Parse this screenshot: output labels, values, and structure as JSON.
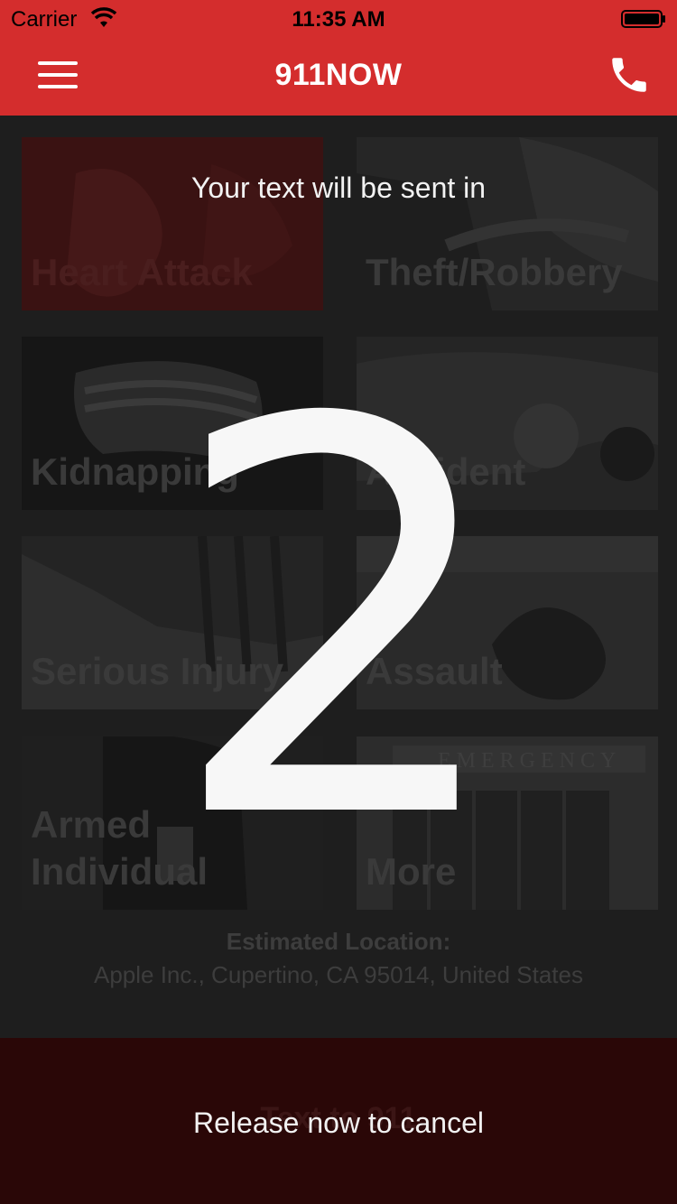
{
  "status_bar": {
    "carrier": "Carrier",
    "time": "11:35 AM",
    "wifi_icon": "wifi-icon",
    "battery_icon": "battery-icon"
  },
  "nav": {
    "title": "911NOW",
    "menu_icon": "hamburger-menu-icon",
    "call_icon": "phone-icon"
  },
  "colors": {
    "brand_red": "#d42d2d",
    "overlay_dark": "#1e1e1e",
    "bottom_bar": "#2a0707"
  },
  "tiles": [
    {
      "label": "Heart Attack"
    },
    {
      "label": "Theft/Robbery"
    },
    {
      "label": "Kidnapping"
    },
    {
      "label": "Accident"
    },
    {
      "label": "Serious Injury"
    },
    {
      "label": "Assault"
    },
    {
      "label": "Armed Individual"
    },
    {
      "label": "More"
    }
  ],
  "location": {
    "title": "Estimated Location:",
    "value": "Apple Inc., Cupertino, CA  95014, United States"
  },
  "bottom_button": {
    "label": "Text to 911"
  },
  "overlay": {
    "message": "Your text will be sent in",
    "countdown": "2",
    "release_hint": "Release now to cancel"
  }
}
